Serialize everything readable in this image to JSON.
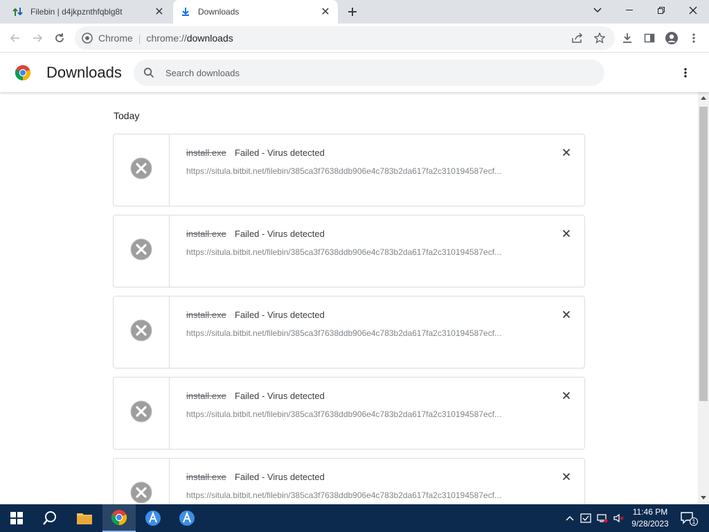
{
  "browser": {
    "tabs": [
      {
        "title": "Filebin | d4jkpznthfqblg8t",
        "active": false
      },
      {
        "title": "Downloads",
        "active": true
      }
    ],
    "omnibox": {
      "chip": "Chrome",
      "separator": "|",
      "scheme": "chrome://",
      "path": "downloads"
    }
  },
  "page": {
    "title": "Downloads",
    "search_placeholder": "Search downloads",
    "section": "Today",
    "downloads": [
      {
        "filename": "install.exe",
        "status": "Failed - Virus detected",
        "url": "https://situla.bitbit.net/filebin/385ca3f7638ddb906e4c783b2da617fa2c310194587ecf..."
      },
      {
        "filename": "install.exe",
        "status": "Failed - Virus detected",
        "url": "https://situla.bitbit.net/filebin/385ca3f7638ddb906e4c783b2da617fa2c310194587ecf..."
      },
      {
        "filename": "install.exe",
        "status": "Failed - Virus detected",
        "url": "https://situla.bitbit.net/filebin/385ca3f7638ddb906e4c783b2da617fa2c310194587ecf..."
      },
      {
        "filename": "install.exe",
        "status": "Failed - Virus detected",
        "url": "https://situla.bitbit.net/filebin/385ca3f7638ddb906e4c783b2da617fa2c310194587ecf..."
      },
      {
        "filename": "install.exe",
        "status": "Failed - Virus detected",
        "url": "https://situla.bitbit.net/filebin/385ca3f7638ddb906e4c783b2da617fa2c310194587ecf..."
      }
    ]
  },
  "taskbar": {
    "time": "11:46 PM",
    "date": "9/28/2023",
    "notification_count": "1"
  },
  "colors": {
    "tab_strip": "#dee1e6",
    "taskbar": "#0c2a4e",
    "failed_icon": "#9e9e9e",
    "accent": "#1a73e8"
  }
}
